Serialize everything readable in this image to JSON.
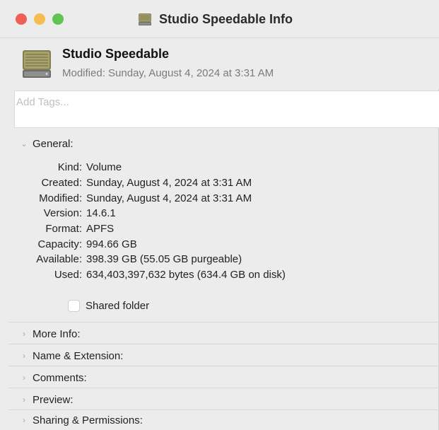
{
  "window": {
    "title": "Studio Speedable Info"
  },
  "header": {
    "name": "Studio Speedable",
    "modified": "Modified: Sunday, August 4, 2024 at 3:31 AM"
  },
  "tags": {
    "placeholder": "Add Tags..."
  },
  "general": {
    "label": "General:",
    "rows": [
      {
        "key": "Kind:",
        "value": "Volume"
      },
      {
        "key": "Created:",
        "value": "Sunday, August 4, 2024 at 3:31 AM"
      },
      {
        "key": "Modified:",
        "value": "Sunday, August 4, 2024 at 3:31 AM"
      },
      {
        "key": "Version:",
        "value": "14.6.1"
      },
      {
        "key": "Format:",
        "value": "APFS"
      },
      {
        "key": "Capacity:",
        "value": "994.66 GB"
      },
      {
        "key": "Available:",
        "value": "398.39 GB (55.05 GB purgeable)"
      },
      {
        "key": "Used:",
        "value": "634,403,397,632 bytes (634.4 GB on disk)"
      }
    ],
    "shared_folder": {
      "label": "Shared folder",
      "checked": false
    }
  },
  "sections": [
    {
      "label": "More Info:"
    },
    {
      "label": "Name & Extension:"
    },
    {
      "label": "Comments:"
    },
    {
      "label": "Preview:"
    },
    {
      "label": "Sharing & Permissions:"
    }
  ],
  "colors": {
    "close": "#ee5f57",
    "minimize": "#f5bd4f",
    "zoom": "#5fc454"
  }
}
